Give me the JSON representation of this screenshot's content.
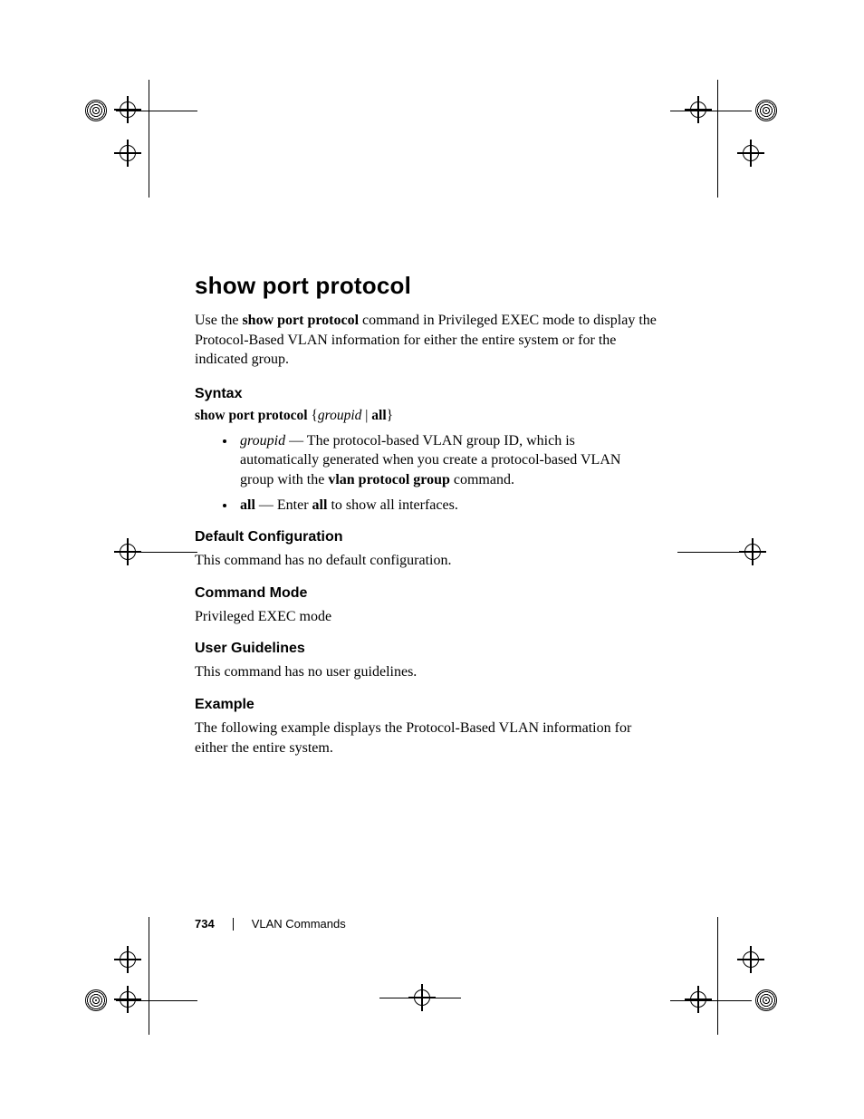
{
  "title": "show port protocol",
  "intro_parts": {
    "pre": "Use the ",
    "cmd": "show port protocol",
    "post": " command in Privileged EXEC mode to display the Protocol-Based VLAN information for either the entire system or for the indicated group."
  },
  "sections": {
    "syntax": {
      "heading": "Syntax",
      "line": {
        "cmd": "show port protocol",
        "open": " {",
        "arg": "groupid",
        "sep": " | ",
        "all": "all",
        "close": "}"
      },
      "bullets": [
        {
          "term_italic": "groupid",
          "dash": " — ",
          "text": "The protocol-based VLAN group ID, which is automatically generated when you create a protocol-based VLAN group with the ",
          "bold_tail": "vlan protocol group",
          "tail": " command."
        },
        {
          "term_bold": "all",
          "dash": " — ",
          "pre": "Enter ",
          "bold_mid": "all",
          "post": " to show all interfaces."
        }
      ]
    },
    "default_config": {
      "heading": "Default Configuration",
      "text": "This command has no default configuration."
    },
    "command_mode": {
      "heading": "Command Mode",
      "text": "Privileged EXEC mode"
    },
    "user_guidelines": {
      "heading": "User Guidelines",
      "text": "This command has no user guidelines."
    },
    "example": {
      "heading": "Example",
      "text": "The following example displays the Protocol-Based VLAN information for either the entire system."
    }
  },
  "footer": {
    "page": "734",
    "chapter": "VLAN Commands"
  }
}
